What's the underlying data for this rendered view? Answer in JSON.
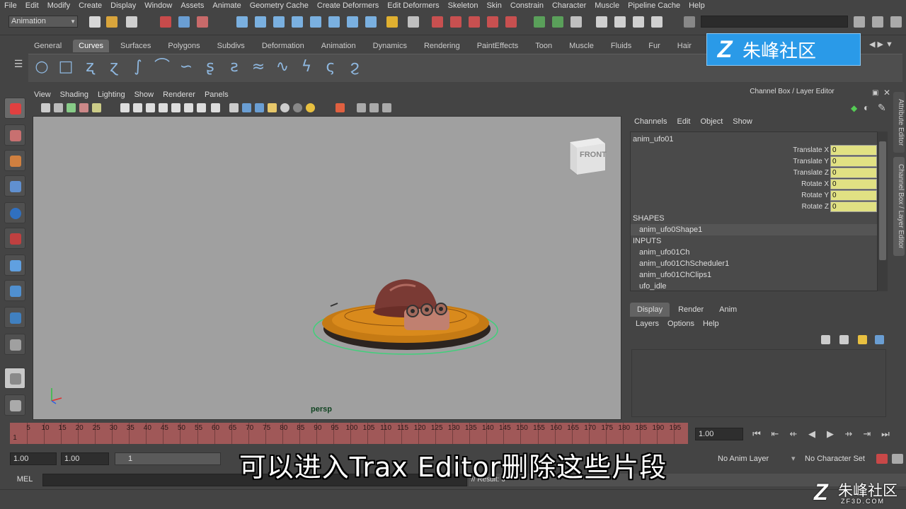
{
  "menubar": [
    "File",
    "Edit",
    "Modify",
    "Create",
    "Display",
    "Window",
    "Assets",
    "Animate",
    "Geometry Cache",
    "Create Deformers",
    "Edit Deformers",
    "Skeleton",
    "Skin",
    "Constrain",
    "Character",
    "Muscle",
    "Pipeline Cache",
    "Help"
  ],
  "statusline": {
    "mode": "Animation"
  },
  "shelf": {
    "tabs": [
      "General",
      "Curves",
      "Surfaces",
      "Polygons",
      "Subdivs",
      "Deformation",
      "Animation",
      "Dynamics",
      "Rendering",
      "PaintEffects",
      "Toon",
      "Muscle",
      "Fluids",
      "Fur",
      "Hair",
      "nClo"
    ],
    "active_tab": "Curves"
  },
  "panel_menu": [
    "View",
    "Shading",
    "Lighting",
    "Show",
    "Renderer",
    "Panels"
  ],
  "viewport": {
    "camera_label": "persp",
    "viewcube_label": "FRONT"
  },
  "channel_box": {
    "title": "Channel Box / Layer Editor",
    "menu": [
      "Channels",
      "Edit",
      "Object",
      "Show"
    ],
    "object": "anim_ufo01",
    "attributes": [
      {
        "name": "Translate X",
        "value": "0"
      },
      {
        "name": "Translate Y",
        "value": "0"
      },
      {
        "name": "Translate Z",
        "value": "0"
      },
      {
        "name": "Rotate X",
        "value": "0"
      },
      {
        "name": "Rotate Y",
        "value": "0"
      },
      {
        "name": "Rotate Z",
        "value": "0"
      }
    ],
    "shapes_header": "SHAPES",
    "shapes": [
      "anim_ufo0Shape1"
    ],
    "inputs_header": "INPUTS",
    "inputs": [
      "anim_ufo01Ch",
      "anim_ufo01ChScheduler1",
      "anim_ufo01ChClips1",
      "ufo_idle"
    ]
  },
  "side_tabs": [
    "Attribute Editor",
    "Channel Box / Layer Editor"
  ],
  "layer_editor": {
    "tabs": [
      "Display",
      "Render",
      "Anim"
    ],
    "active_tab": "Display",
    "menu": [
      "Layers",
      "Options",
      "Help"
    ]
  },
  "timeline": {
    "ticks": [
      "5",
      "10",
      "15",
      "20",
      "25",
      "30",
      "35",
      "40",
      "45",
      "50",
      "55",
      "60",
      "65",
      "70",
      "75",
      "80",
      "85",
      "90",
      "95",
      "100",
      "105",
      "110",
      "115",
      "120",
      "125",
      "130",
      "135",
      "140",
      "145",
      "150",
      "155",
      "160",
      "165",
      "170",
      "175",
      "180",
      "185",
      "190",
      "195",
      "20"
    ],
    "start_label": "1",
    "current_frame": "1.00"
  },
  "range": {
    "start": "1.00",
    "playback_start": "1.00",
    "slider_value": "1",
    "anim_layer": "No Anim Layer",
    "character_set": "No Character Set"
  },
  "command": {
    "mel_label": "MEL",
    "result": "// Result: 6"
  },
  "overlay": {
    "subtitle": "可以进入Trax Editor删除这些片段",
    "logo_text": "朱峰社区",
    "logo_url": "ZF3D.COM"
  },
  "colors": {
    "accent": "#2a9ae8",
    "timeline": "#a05858",
    "attr_field": "#e1e183"
  }
}
